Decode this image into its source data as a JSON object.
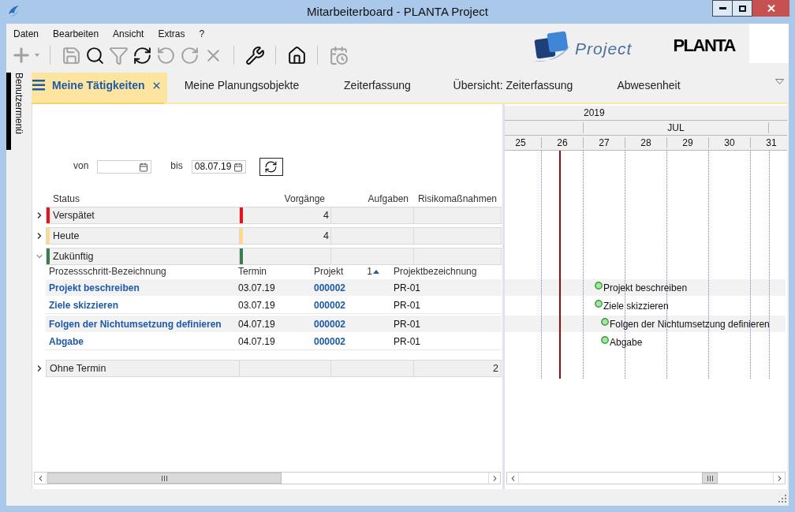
{
  "window": {
    "title": "Mitarbeiterboard - PLANTA Project"
  },
  "menu": [
    "Daten",
    "Bearbeiten",
    "Ansicht",
    "Extras",
    "?"
  ],
  "toolbar": {
    "groups": [
      {
        "buttons": [
          {
            "kind": "add",
            "disabled": true
          }
        ]
      },
      {
        "buttons": [
          {
            "kind": "save",
            "disabled": true
          },
          {
            "kind": "search",
            "disabled": false
          },
          {
            "kind": "filter",
            "disabled": true
          },
          {
            "kind": "refresh",
            "disabled": false
          },
          {
            "kind": "undo",
            "disabled": true
          },
          {
            "kind": "redo",
            "disabled": true
          },
          {
            "kind": "delete",
            "disabled": true
          }
        ]
      },
      {
        "buttons": [
          {
            "kind": "tools",
            "disabled": false
          }
        ]
      },
      {
        "buttons": [
          {
            "kind": "home",
            "disabled": false
          }
        ]
      },
      {
        "buttons": [
          {
            "kind": "calendar",
            "disabled": true
          }
        ]
      }
    ]
  },
  "logo": {
    "product": "Project",
    "brand": "PLANTA"
  },
  "sidebar": {
    "label": "Benutzermenü"
  },
  "tabs": [
    {
      "label": "Meine Tätigkeiten",
      "selected": true
    },
    {
      "label": "Meine Planungsobjekte",
      "selected": false
    },
    {
      "label": "Zeiterfassung",
      "selected": false
    },
    {
      "label": "Übersicht: Zeiterfassung",
      "selected": false
    },
    {
      "label": "Abwesenheit",
      "selected": false
    }
  ],
  "filter": {
    "from": {
      "label": "von"
    },
    "to": {
      "label": "bis",
      "value": "08.07.19"
    }
  },
  "status_table": {
    "columns": [
      "Status",
      "Vorgänge",
      "Aufgaben",
      "Risikomaßnahmen"
    ],
    "groups": [
      {
        "label": "Verspätet",
        "color": "#e8121c",
        "expanded": false,
        "vorgaenge": "4"
      },
      {
        "label": "Heute",
        "color": "#ffd984",
        "expanded": false,
        "vorgaenge": "4"
      },
      {
        "label": "Zukünftig",
        "color": "#3b7d50",
        "expanded": true,
        "detail": {
          "columns": [
            {
              "label": "Prozessschritt-Bezeichnung"
            },
            {
              "label": "Termin"
            },
            {
              "label": "Projekt",
              "sort_rank": "1",
              "sort_ascending": true
            },
            {
              "label": "Projektbezeichnung"
            }
          ],
          "rows": [
            {
              "name": "Projekt beschreiben",
              "termin": "03.07.19",
              "projekt": "000002",
              "projektbezeichnung": "PR-01"
            },
            {
              "name": "Ziele skizzieren",
              "termin": "03.07.19",
              "projekt": "000002",
              "projektbezeichnung": "PR-01"
            },
            {
              "name": "Folgen der Nichtumsetzung definieren",
              "termin": "04.07.19",
              "projekt": "000002",
              "projektbezeichnung": "PR-01"
            },
            {
              "name": "Abgabe",
              "termin": "04.07.19",
              "projekt": "000002",
              "projektbezeichnung": "PR-01"
            }
          ]
        }
      },
      {
        "label": "Ohne Termin",
        "expanded": false,
        "risikomassnahmen": "2"
      }
    ]
  },
  "gantt": {
    "year": "2019",
    "month": "JUL",
    "days": [
      "25",
      "26",
      "27",
      "28",
      "29",
      "30",
      "31"
    ],
    "milestones": [
      {
        "label": "Projekt beschreiben"
      },
      {
        "label": "Ziele skizzieren"
      },
      {
        "label": "Folgen der Nichtumsetzung definieren"
      },
      {
        "label": "Abgabe"
      }
    ]
  }
}
